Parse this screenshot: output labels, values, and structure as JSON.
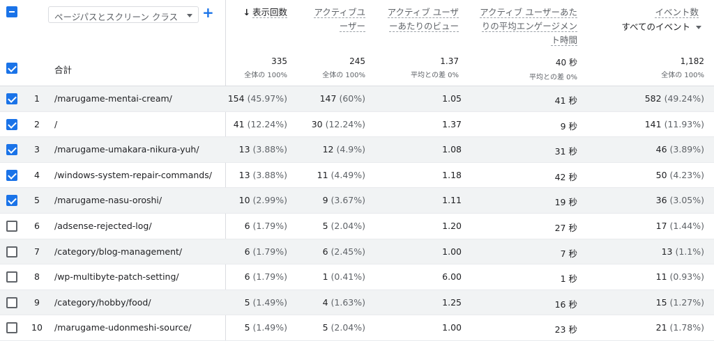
{
  "header": {
    "dimension_select": "ページパスとスクリーン クラス",
    "add_dimension": "+",
    "total_label": "合計",
    "columns": [
      {
        "label": "表示回数",
        "sorted": true,
        "total": "335",
        "total_sub": "全体の 100%"
      },
      {
        "label": "アクティブユーザー",
        "total": "245",
        "total_sub": "全体の 100%"
      },
      {
        "label": "アクティブ ユーザーあたりのビュー",
        "total": "1.37",
        "total_sub": "平均との差 0%"
      },
      {
        "label": "アクティブ ユーザーあたりの平均エンゲージメント時間",
        "total": "40 秒",
        "total_sub": "平均との差 0%"
      },
      {
        "label": "イベント数",
        "sub": "すべてのイベント",
        "total": "1,182",
        "total_sub": "全体の 100%"
      }
    ]
  },
  "rows": [
    {
      "n": "1",
      "page": "/marugame-mentai-cream/",
      "checked": true,
      "views": "154",
      "views_p": "(45.97%)",
      "users": "147",
      "users_p": "(60%)",
      "vpu": "1.05",
      "time": "41 秒",
      "events": "582",
      "events_p": "(49.24%)"
    },
    {
      "n": "2",
      "page": "/",
      "checked": true,
      "views": "41",
      "views_p": "(12.24%)",
      "users": "30",
      "users_p": "(12.24%)",
      "vpu": "1.37",
      "time": "9 秒",
      "events": "141",
      "events_p": "(11.93%)"
    },
    {
      "n": "3",
      "page": "/marugame-umakara-nikura-yuh/",
      "checked": true,
      "views": "13",
      "views_p": "(3.88%)",
      "users": "12",
      "users_p": "(4.9%)",
      "vpu": "1.08",
      "time": "31 秒",
      "events": "46",
      "events_p": "(3.89%)"
    },
    {
      "n": "4",
      "page": "/windows-system-repair-commands/",
      "checked": true,
      "views": "13",
      "views_p": "(3.88%)",
      "users": "11",
      "users_p": "(4.49%)",
      "vpu": "1.18",
      "time": "42 秒",
      "events": "50",
      "events_p": "(4.23%)"
    },
    {
      "n": "5",
      "page": "/marugame-nasu-oroshi/",
      "checked": true,
      "views": "10",
      "views_p": "(2.99%)",
      "users": "9",
      "users_p": "(3.67%)",
      "vpu": "1.11",
      "time": "19 秒",
      "events": "36",
      "events_p": "(3.05%)"
    },
    {
      "n": "6",
      "page": "/adsense-rejected-log/",
      "checked": false,
      "views": "6",
      "views_p": "(1.79%)",
      "users": "5",
      "users_p": "(2.04%)",
      "vpu": "1.20",
      "time": "27 秒",
      "events": "17",
      "events_p": "(1.44%)"
    },
    {
      "n": "7",
      "page": "/category/blog-management/",
      "checked": false,
      "views": "6",
      "views_p": "(1.79%)",
      "users": "6",
      "users_p": "(2.45%)",
      "vpu": "1.00",
      "time": "7 秒",
      "events": "13",
      "events_p": "(1.1%)"
    },
    {
      "n": "8",
      "page": "/wp-multibyte-patch-setting/",
      "checked": false,
      "views": "6",
      "views_p": "(1.79%)",
      "users": "1",
      "users_p": "(0.41%)",
      "vpu": "6.00",
      "time": "1 秒",
      "events": "11",
      "events_p": "(0.93%)"
    },
    {
      "n": "9",
      "page": "/category/hobby/food/",
      "checked": false,
      "views": "5",
      "views_p": "(1.49%)",
      "users": "4",
      "users_p": "(1.63%)",
      "vpu": "1.25",
      "time": "16 秒",
      "events": "15",
      "events_p": "(1.27%)"
    },
    {
      "n": "10",
      "page": "/marugame-udonmeshi-source/",
      "checked": false,
      "views": "5",
      "views_p": "(1.49%)",
      "users": "5",
      "users_p": "(2.04%)",
      "vpu": "1.00",
      "time": "23 秒",
      "events": "21",
      "events_p": "(1.78%)"
    }
  ]
}
